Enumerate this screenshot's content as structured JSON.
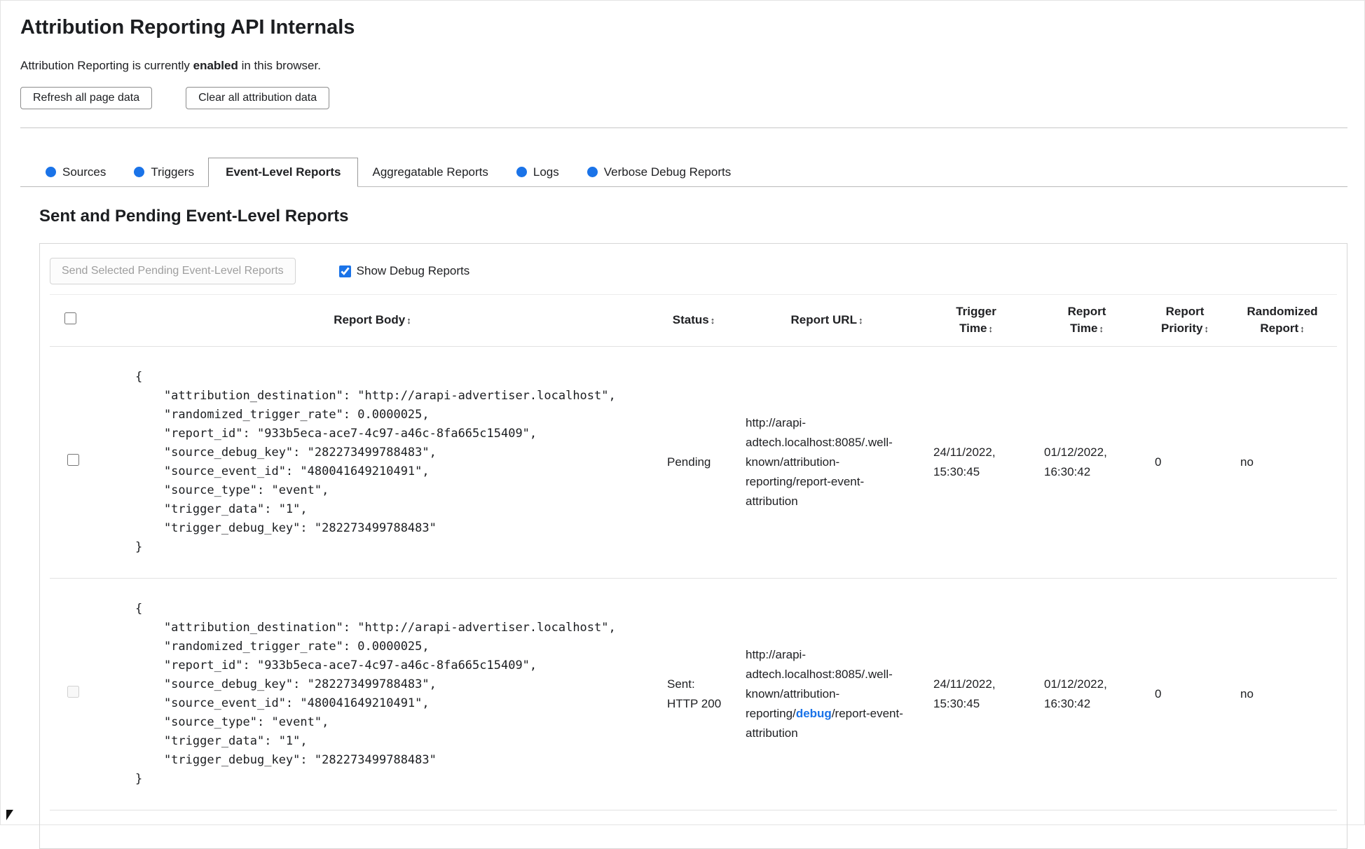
{
  "colors": {
    "accent_blue": "#1a73e8",
    "panel_border": "#d7d7d7"
  },
  "icons": {
    "sort": "↕"
  },
  "header": {
    "title": "Attribution Reporting API Internals",
    "status_prefix": "Attribution Reporting is currently ",
    "status_bold": "enabled",
    "status_suffix": " in this browser.",
    "refresh_button": "Refresh all page data",
    "clear_button": "Clear all attribution data"
  },
  "tabs": {
    "sources": {
      "label": "Sources"
    },
    "triggers": {
      "label": "Triggers"
    },
    "event_level": {
      "label": "Event-Level Reports"
    },
    "aggregatable": {
      "label": "Aggregatable Reports"
    },
    "logs": {
      "label": "Logs"
    },
    "verbose": {
      "label": "Verbose Debug Reports"
    }
  },
  "section": {
    "heading": "Sent and Pending Event-Level Reports",
    "send_button": "Send Selected Pending Event-Level Reports",
    "show_debug_label": "Show Debug Reports",
    "show_debug_state": "checked"
  },
  "table": {
    "headers": {
      "report_body": "Report Body",
      "status": "Status",
      "report_url": "Report URL",
      "trigger_time": "Trigger Time",
      "report_time": "Report Time",
      "report_priority": "Report Priority",
      "randomized_report": "Randomized Report"
    },
    "rows": [
      {
        "report_body": "{\n    \"attribution_destination\": \"http://arapi-advertiser.localhost\",\n    \"randomized_trigger_rate\": 0.0000025,\n    \"report_id\": \"933b5eca-ace7-4c97-a46c-8fa665c15409\",\n    \"source_debug_key\": \"282273499788483\",\n    \"source_event_id\": \"480041649210491\",\n    \"source_type\": \"event\",\n    \"trigger_data\": \"1\",\n    \"trigger_debug_key\": \"282273499788483\"\n}",
        "status": "Pending",
        "url_prefix": "http://arapi-adtech.localhost:8085/.well-known/attribution-reporting/report-event-attribution",
        "url_debug": "",
        "url_suffix": "",
        "trigger_time": "24/11/2022, 15:30:45",
        "report_time": "01/12/2022, 16:30:42",
        "report_priority": "0",
        "randomized_report": "no"
      },
      {
        "report_body": "{\n    \"attribution_destination\": \"http://arapi-advertiser.localhost\",\n    \"randomized_trigger_rate\": 0.0000025,\n    \"report_id\": \"933b5eca-ace7-4c97-a46c-8fa665c15409\",\n    \"source_debug_key\": \"282273499788483\",\n    \"source_event_id\": \"480041649210491\",\n    \"source_type\": \"event\",\n    \"trigger_data\": \"1\",\n    \"trigger_debug_key\": \"282273499788483\"\n}",
        "status": "Sent: HTTP 200",
        "url_prefix": "http://arapi-adtech.localhost:8085/.well-known/attribution-reporting/",
        "url_debug": "debug",
        "url_suffix": "/report-event-attribution",
        "trigger_time": "24/11/2022, 15:30:45",
        "report_time": "01/12/2022, 16:30:42",
        "report_priority": "0",
        "randomized_report": "no",
        "checkbox_state": "disabled"
      }
    ]
  }
}
